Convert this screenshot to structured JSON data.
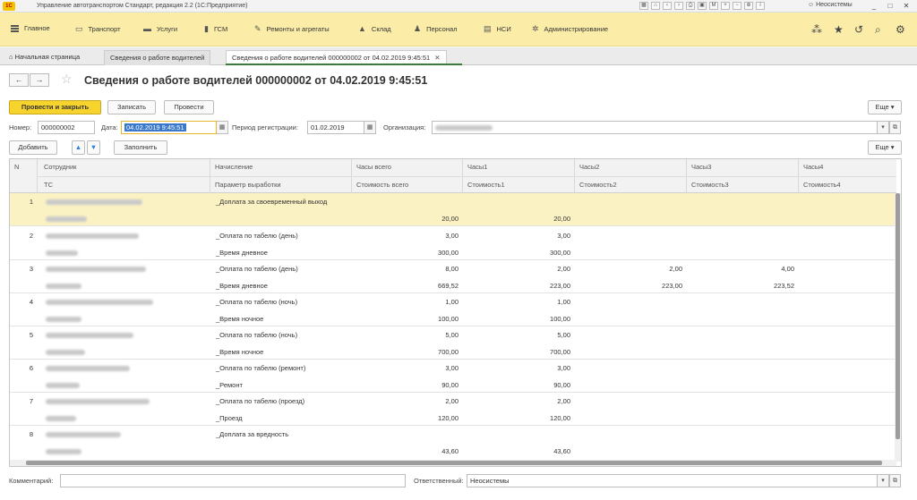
{
  "window": {
    "title": "Управление автотранспортом Стандарт, редакция 2.2  (1С:Предприятие)",
    "user": "Неосистемы",
    "logo_text": "1С"
  },
  "menu": {
    "items": [
      {
        "label": "Главное",
        "icon": "hamburger-icon"
      },
      {
        "label": "Транспорт",
        "icon": "bus-icon"
      },
      {
        "label": "Услуги",
        "icon": "truck-icon"
      },
      {
        "label": "ГСМ",
        "icon": "fuel-icon"
      },
      {
        "label": "Ремонты и агрегаты",
        "icon": "wrench-icon"
      },
      {
        "label": "Склад",
        "icon": "warehouse-icon"
      },
      {
        "label": "Персонал",
        "icon": "person-icon"
      },
      {
        "label": "НСИ",
        "icon": "reference-icon"
      },
      {
        "label": "Администрирование",
        "icon": "gear-icon"
      }
    ]
  },
  "tabs": [
    {
      "label": "Начальная страница"
    },
    {
      "label": "Сведения о работе водителей"
    },
    {
      "label": "Сведения о работе водителей 000000002 от 04.02.2019 9:45:51"
    }
  ],
  "form": {
    "title": "Сведения о работе водителей 000000002 от 04.02.2019 9:45:51",
    "buttons": {
      "post_close": "Провести и закрыть",
      "save": "Записать",
      "post": "Провести",
      "more": "Еще",
      "add": "Добавить",
      "fill": "Заполнить",
      "more2": "Еще"
    },
    "fields": {
      "number_label": "Номер:",
      "number_value": "000000002",
      "date_label": "Дата:",
      "date_value": "04.02.2019  9:45:51",
      "period_label": "Период регистрации:",
      "period_value": "01.02.2019",
      "org_label": "Организация:",
      "comment_label": "Комментарий:",
      "responsible_label": "Ответственный:",
      "responsible_value": "Неосистемы"
    }
  },
  "table": {
    "headers_top": [
      "N",
      "Сотрудник",
      "Начисление",
      "Часы всего",
      "Часы1",
      "Часы2",
      "Часы3",
      "Часы4"
    ],
    "headers_bottom": [
      "ТС",
      "Параметр выработки",
      "Стоимость всего",
      "Стоимость1",
      "Стоимость2",
      "Стоимость3",
      "Стоимость4"
    ],
    "rows": [
      {
        "n": "1",
        "accrual": "_Доплата за своевременный выход",
        "param": "",
        "hours_total": "",
        "hours1": "",
        "hours2": "",
        "hours3": "",
        "cost_total": "20,00",
        "cost1": "20,00",
        "cost2": "",
        "cost3": ""
      },
      {
        "n": "2",
        "accrual": "_Оплата по табелю (день)",
        "param": "_Время дневное",
        "hours_total": "3,00",
        "hours1": "3,00",
        "hours2": "",
        "hours3": "",
        "cost_total": "300,00",
        "cost1": "300,00",
        "cost2": "",
        "cost3": ""
      },
      {
        "n": "3",
        "accrual": "_Оплата по табелю (день)",
        "param": "_Время дневное",
        "hours_total": "8,00",
        "hours1": "2,00",
        "hours2": "2,00",
        "hours3": "4,00",
        "cost_total": "669,52",
        "cost1": "223,00",
        "cost2": "223,00",
        "cost3": "223,52"
      },
      {
        "n": "4",
        "accrual": "_Оплата по табелю (ночь)",
        "param": "_Время ночное",
        "hours_total": "1,00",
        "hours1": "1,00",
        "hours2": "",
        "hours3": "",
        "cost_total": "100,00",
        "cost1": "100,00",
        "cost2": "",
        "cost3": ""
      },
      {
        "n": "5",
        "accrual": "_Оплата по табелю (ночь)",
        "param": "_Время ночное",
        "hours_total": "5,00",
        "hours1": "5,00",
        "hours2": "",
        "hours3": "",
        "cost_total": "700,00",
        "cost1": "700,00",
        "cost2": "",
        "cost3": ""
      },
      {
        "n": "6",
        "accrual": "_Оплата по табелю (ремонт)",
        "param": "_Ремонт",
        "hours_total": "3,00",
        "hours1": "3,00",
        "hours2": "",
        "hours3": "",
        "cost_total": "90,00",
        "cost1": "90,00",
        "cost2": "",
        "cost3": ""
      },
      {
        "n": "7",
        "accrual": "_Оплата по табелю (проезд)",
        "param": "_Проезд",
        "hours_total": "2,00",
        "hours1": "2,00",
        "hours2": "",
        "hours3": "",
        "cost_total": "120,00",
        "cost1": "120,00",
        "cost2": "",
        "cost3": ""
      },
      {
        "n": "8",
        "accrual": "_Доплата за вредность",
        "param": "",
        "hours_total": "",
        "hours1": "",
        "hours2": "",
        "hours3": "",
        "cost_total": "43,60",
        "cost1": "43,60",
        "cost2": "",
        "cost3": ""
      }
    ]
  },
  "colors": {
    "menu_bg": "#fbeda8",
    "primary_button": "#f7d42d",
    "selected_row": "#fbf2c4",
    "active_tab_accent": "#3b7b3b"
  }
}
